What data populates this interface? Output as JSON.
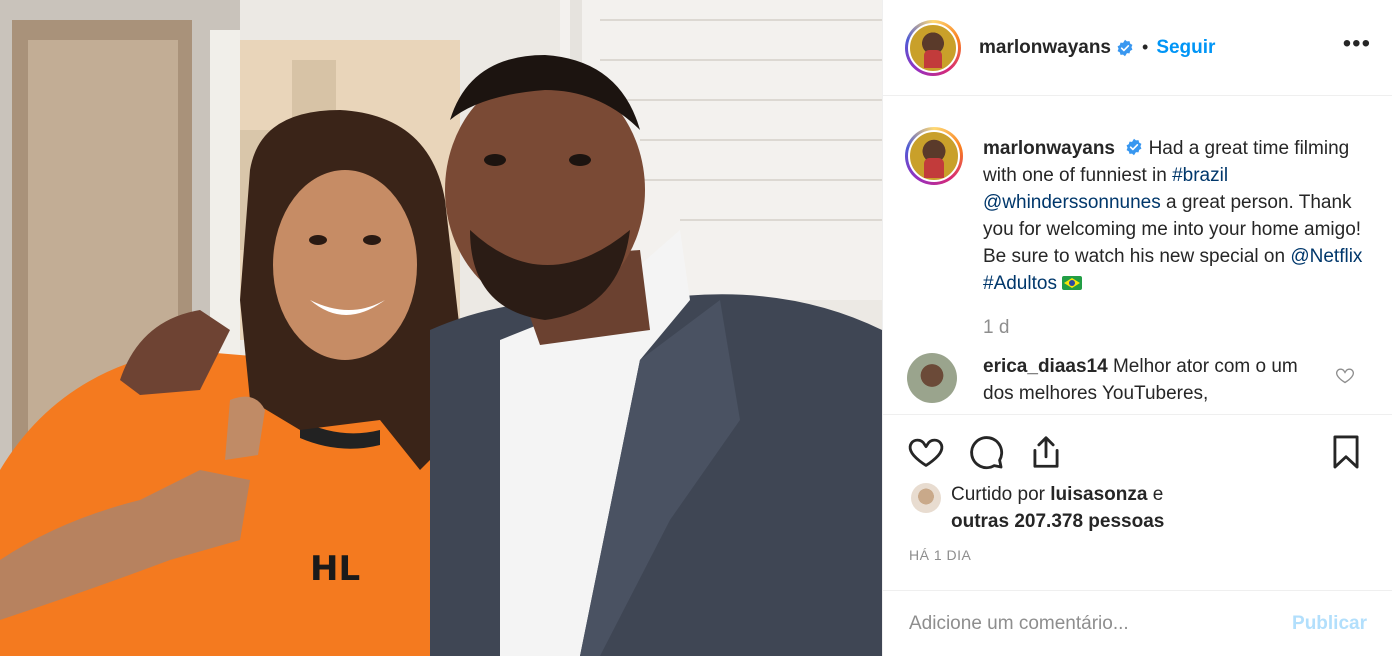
{
  "post": {
    "username": "marlonwayans",
    "verified_icon": "verified-badge-icon",
    "separator": "•",
    "follow_label": "Seguir",
    "more_label": "•••"
  },
  "caption": {
    "username": "marlonwayans",
    "text_1": "Had a great time filming with one of funniest in ",
    "tag_brazil": "#brazil",
    "mention_whindersson": "@whinderssonnunes",
    "text_2": " a great person. Thank you for welcoming me into your home amigo! Be sure to watch his new special on ",
    "mention_netflix": "@Netflix",
    "tag_adultos": "#Adultos",
    "flag_icon": "brazil-flag-icon",
    "age_short": "1 d"
  },
  "comment": {
    "username": "erica_diaas14",
    "text": "Melhor ator com o um dos melhores YouTuberes,"
  },
  "actions": {
    "like_icon": "heart-icon",
    "comment_icon": "comment-icon",
    "share_icon": "share-icon",
    "save_icon": "bookmark-icon"
  },
  "likes": {
    "prefix": "Curtido por ",
    "user": "luisasonza",
    "joiner": " e",
    "others": "outras 207.378 pessoas"
  },
  "age": "HÁ 1 DIA",
  "add_comment": {
    "placeholder": "Adicione um comentário...",
    "publish_label": "Publicar"
  },
  "colors": {
    "link_blue": "#0095f6",
    "tag_blue": "#00376b",
    "muted": "#8e8e8e",
    "publish_disabled": "#b2dffc",
    "shirt_orange": "#f47a1f"
  }
}
